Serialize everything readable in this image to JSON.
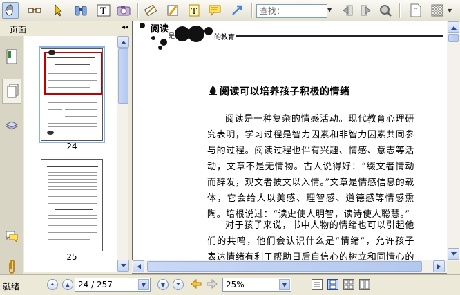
{
  "toolbar": {
    "tools": [
      "hand-tool",
      "reading-glasses",
      "select-arrow",
      "binoculars",
      "text-select",
      "snapshot-camera",
      "eraser-pencil",
      "highlighter",
      "text-tool",
      "note-tool",
      "arrow-tool",
      "prev-result",
      "next-result",
      "search-web",
      "page-setup",
      "checkered"
    ],
    "find_placeholder": "查找："
  },
  "left_panel": {
    "title": "页面",
    "thumbnails": [
      {
        "label": "24",
        "selected": true
      },
      {
        "label": "25",
        "selected": false
      }
    ]
  },
  "document": {
    "header": {
      "title_main": "阅读",
      "title_prefix": "是",
      "title_suffix": "的教育"
    },
    "article_title": "阅读可以培养孩子积极的情绪",
    "paragraphs": [
      "阅读是一种复杂的情感活动。现代教育心理研究表明，学习过程是智力因素和非智力因素共同参与的过程。阅读过程也伴有兴趣、情感、意志等活动，文章不是无情物。古人说得好：“缀文者情动而辞发，观文者披文以入情。”文章是情感信息的载体，它会给人以美感、理智感、道德感等情感熏陶。培根说过：“读史使人明智，读诗使人聪慧。”",
      "对于孩子来说，书中人物的情绪也可以引起他们的共鸣，他们会认识什么是“情绪”，允许孩子表达情绪有利于帮助日后自信心的树立和同情心的培养。比如，书里的"
    ]
  },
  "statusbar": {
    "status": "就绪",
    "page_field": "24 / 257",
    "zoom_field": "25%"
  },
  "colors": {
    "selection_border": "#8cb0e0",
    "thumb_highlight": "#c00000",
    "scroll": "#c5d5f1"
  }
}
